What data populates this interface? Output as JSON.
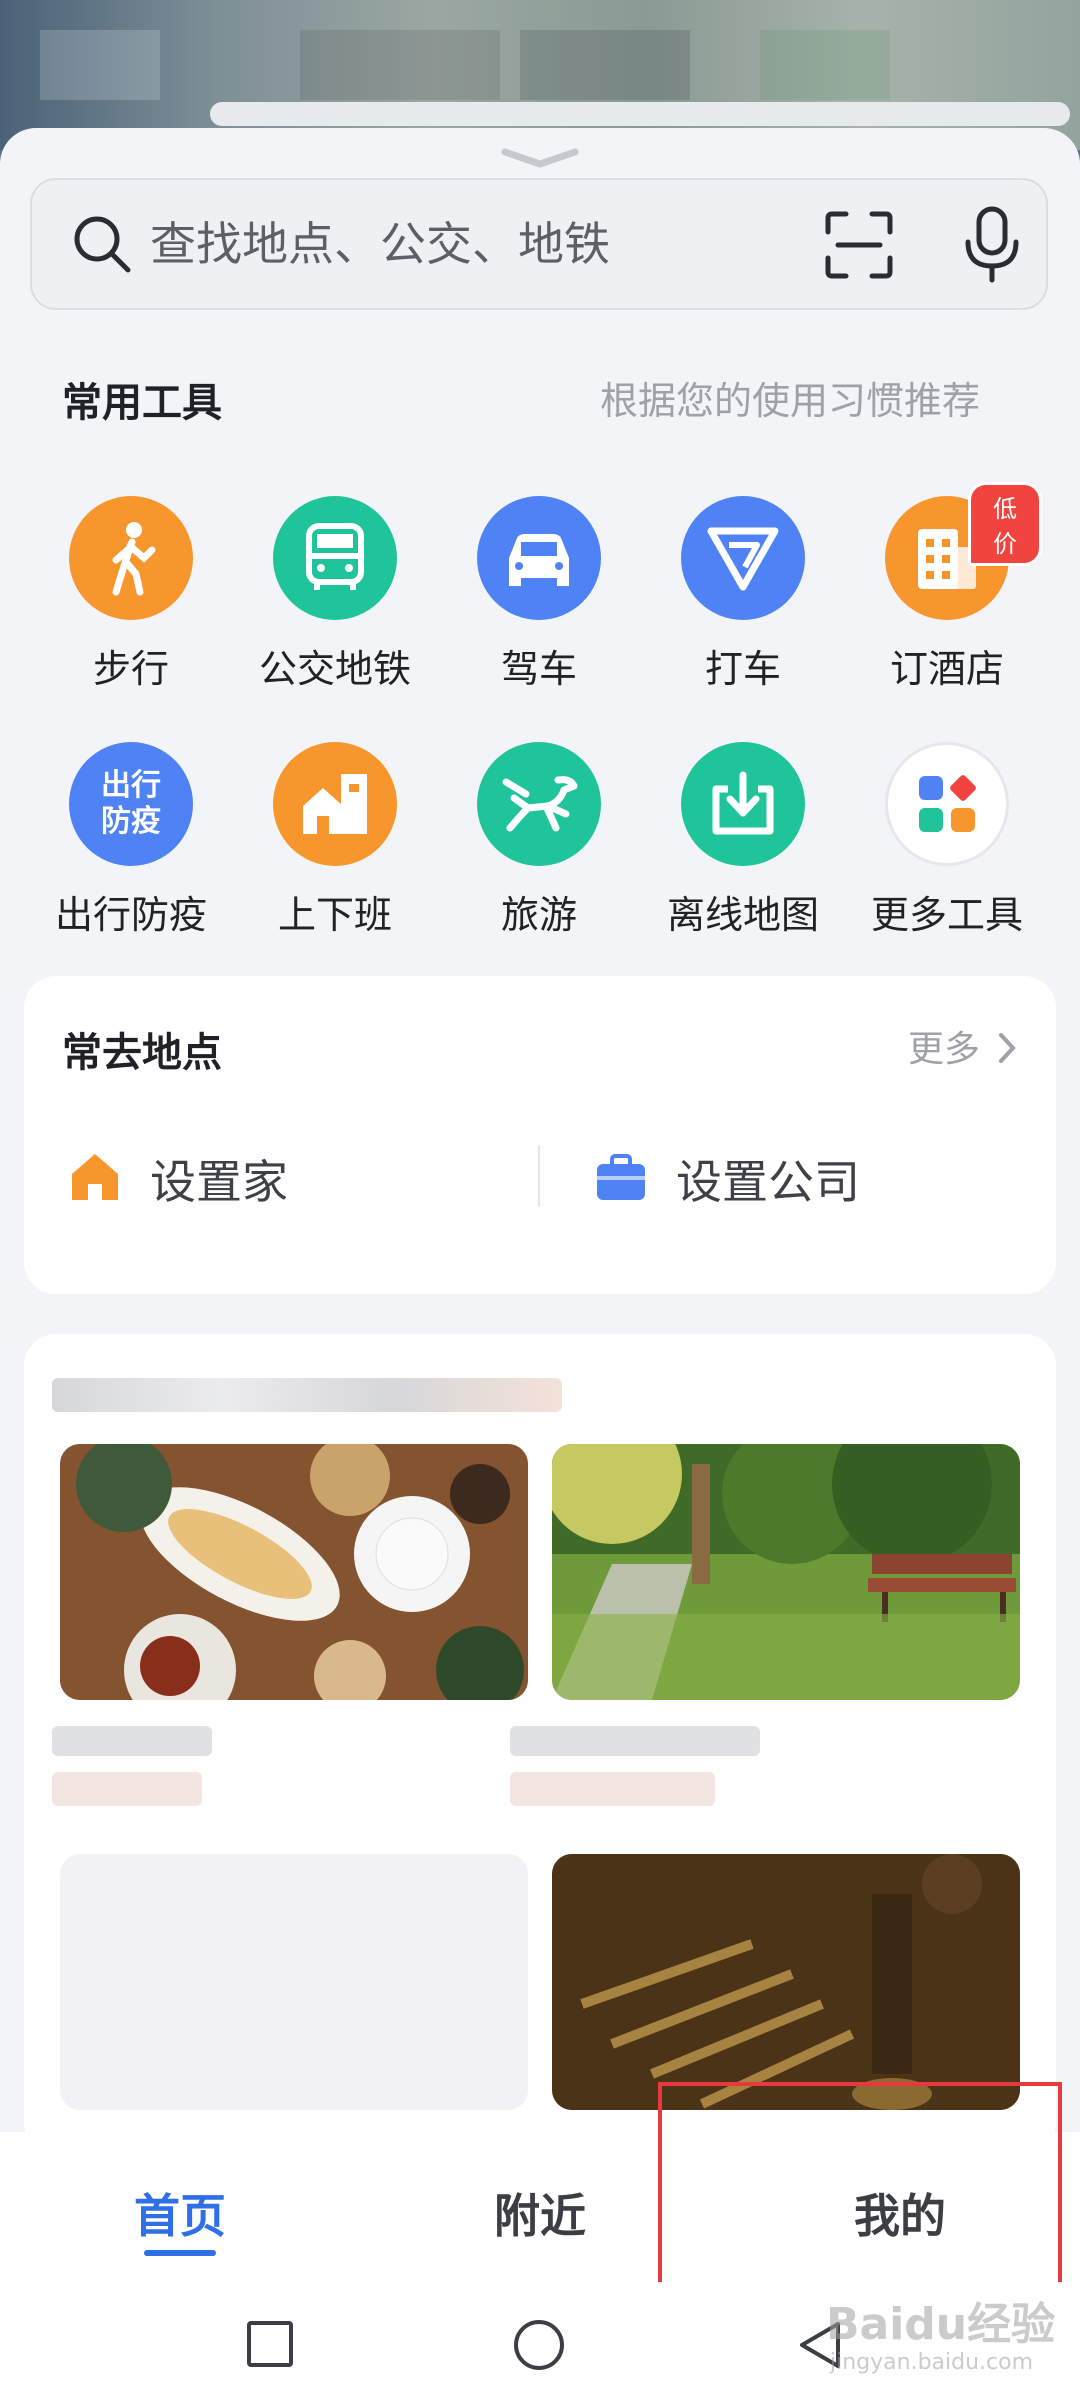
{
  "search": {
    "placeholder": "查找地点、公交、地铁"
  },
  "tools_section": {
    "title": "常用工具",
    "note": "根据您的使用习惯推荐"
  },
  "tools": [
    {
      "label": "步行",
      "icon": "walk-icon",
      "color": "#f7962c"
    },
    {
      "label": "公交地铁",
      "icon": "bus-icon",
      "color": "#1fc49a"
    },
    {
      "label": "驾车",
      "icon": "car-icon",
      "color": "#4f83f5"
    },
    {
      "label": "打车",
      "icon": "taxi-icon",
      "color": "#4f83f5"
    },
    {
      "label": "订酒店",
      "icon": "hotel-icon",
      "color": "#f7962c",
      "badge": "低价"
    },
    {
      "label": "出行防疫",
      "icon": "epidemic-icon",
      "color": "#4f83f5",
      "icon_text": "出行\n防疫"
    },
    {
      "label": "上下班",
      "icon": "commute-icon",
      "color": "#f7962c"
    },
    {
      "label": "旅游",
      "icon": "travel-horse-icon",
      "color": "#1fc49a"
    },
    {
      "label": "离线地图",
      "icon": "offline-map-icon",
      "color": "#1fc49a"
    },
    {
      "label": "更多工具",
      "icon": "more-tools-icon",
      "color": "#ffffff"
    }
  ],
  "frequent": {
    "title": "常去地点",
    "more": "更多",
    "home": "设置家",
    "company": "设置公司"
  },
  "tabs": [
    {
      "label": "首页"
    },
    {
      "label": "附近"
    },
    {
      "label": "我的"
    }
  ],
  "watermark": {
    "main": "Baidu经验",
    "sub": "jingyan.baidu.com"
  },
  "colors": {
    "accent": "#2f6fe8",
    "highlight": "#e8393f"
  }
}
